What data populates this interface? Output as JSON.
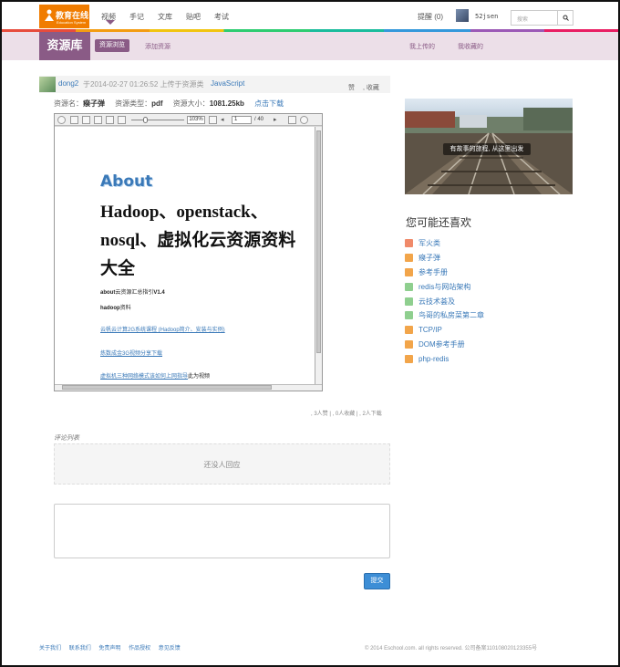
{
  "header": {
    "logo_cn": "教育在线",
    "logo_en": "Education System",
    "nav": [
      "视频",
      "手记",
      "文库",
      "贴吧",
      "考试"
    ],
    "remind": "提醒 (0)",
    "username": "52jsen",
    "search_placeholder": "搜索",
    "search_icon": "search-icon"
  },
  "subnav": {
    "title": "资源库",
    "tabs": [
      "资源浏览",
      "添加资源"
    ],
    "right": [
      "我上传的",
      "我收藏的"
    ]
  },
  "post": {
    "author": "dong2",
    "meta": "于2014-02-27 01:26:52 上传于资源类",
    "category": "JavaScript",
    "like": "赞",
    "fav": ", 收藏"
  },
  "resource": {
    "name_label": "资源名：",
    "name": "瘊子弹",
    "type_label": "资源类型：",
    "type": "pdf",
    "size_label": "资源大小：",
    "size": "1081.25kb",
    "download": "点击下载"
  },
  "viewer": {
    "zoom": "103%",
    "page": "1",
    "total": "/ 40",
    "doc": {
      "about": "About",
      "title": "Hadoop、openstack、nosql、虚拟化云资源资料大全",
      "line1_bold": "about",
      "line1": "云资源汇总指引",
      "line1_ver": "V1.4",
      "line2_bold": "hadoop",
      "line2": "资料",
      "link1": "云帆云计算2G系统课程 (Hadoop简介、安装与实例)",
      "link2": "炼数成金3G视频分享下载",
      "link3": "虚拟机三种网络模式该如何上网指导",
      "link3_tail": "此为视频"
    }
  },
  "stats": ", 3人赞 | , 0人收藏 | , 2人下载",
  "comments": {
    "title": "评论列表",
    "empty": "还没人回应",
    "submit": "提交"
  },
  "sidebar": {
    "banner_caption": "有故事的旅程, 从这里出发",
    "like_title": "您可能还喜欢",
    "items": [
      {
        "label": "军火类",
        "color": "#f08a6a"
      },
      {
        "label": "瘊子弹",
        "color": "#f2a54a"
      },
      {
        "label": "参考手册",
        "color": "#f2a54a"
      },
      {
        "label": "redis与网站架构",
        "color": "#8fcf8f"
      },
      {
        "label": "云技术荟及",
        "color": "#8fcf8f"
      },
      {
        "label": "鸟哥的私房菜第二章",
        "color": "#8fcf8f"
      },
      {
        "label": "TCP/IP",
        "color": "#f2a54a"
      },
      {
        "label": "DOM参考手册",
        "color": "#f2a54a"
      },
      {
        "label": "php-redis",
        "color": "#f2a54a"
      }
    ]
  },
  "footer": {
    "links": [
      "关于我们",
      "联系我们",
      "免责声明",
      "作品授权",
      "意见反馈"
    ],
    "copyright": "© 2014 Eschool.com. all rights reserved. 公司备案110108020123355号"
  }
}
